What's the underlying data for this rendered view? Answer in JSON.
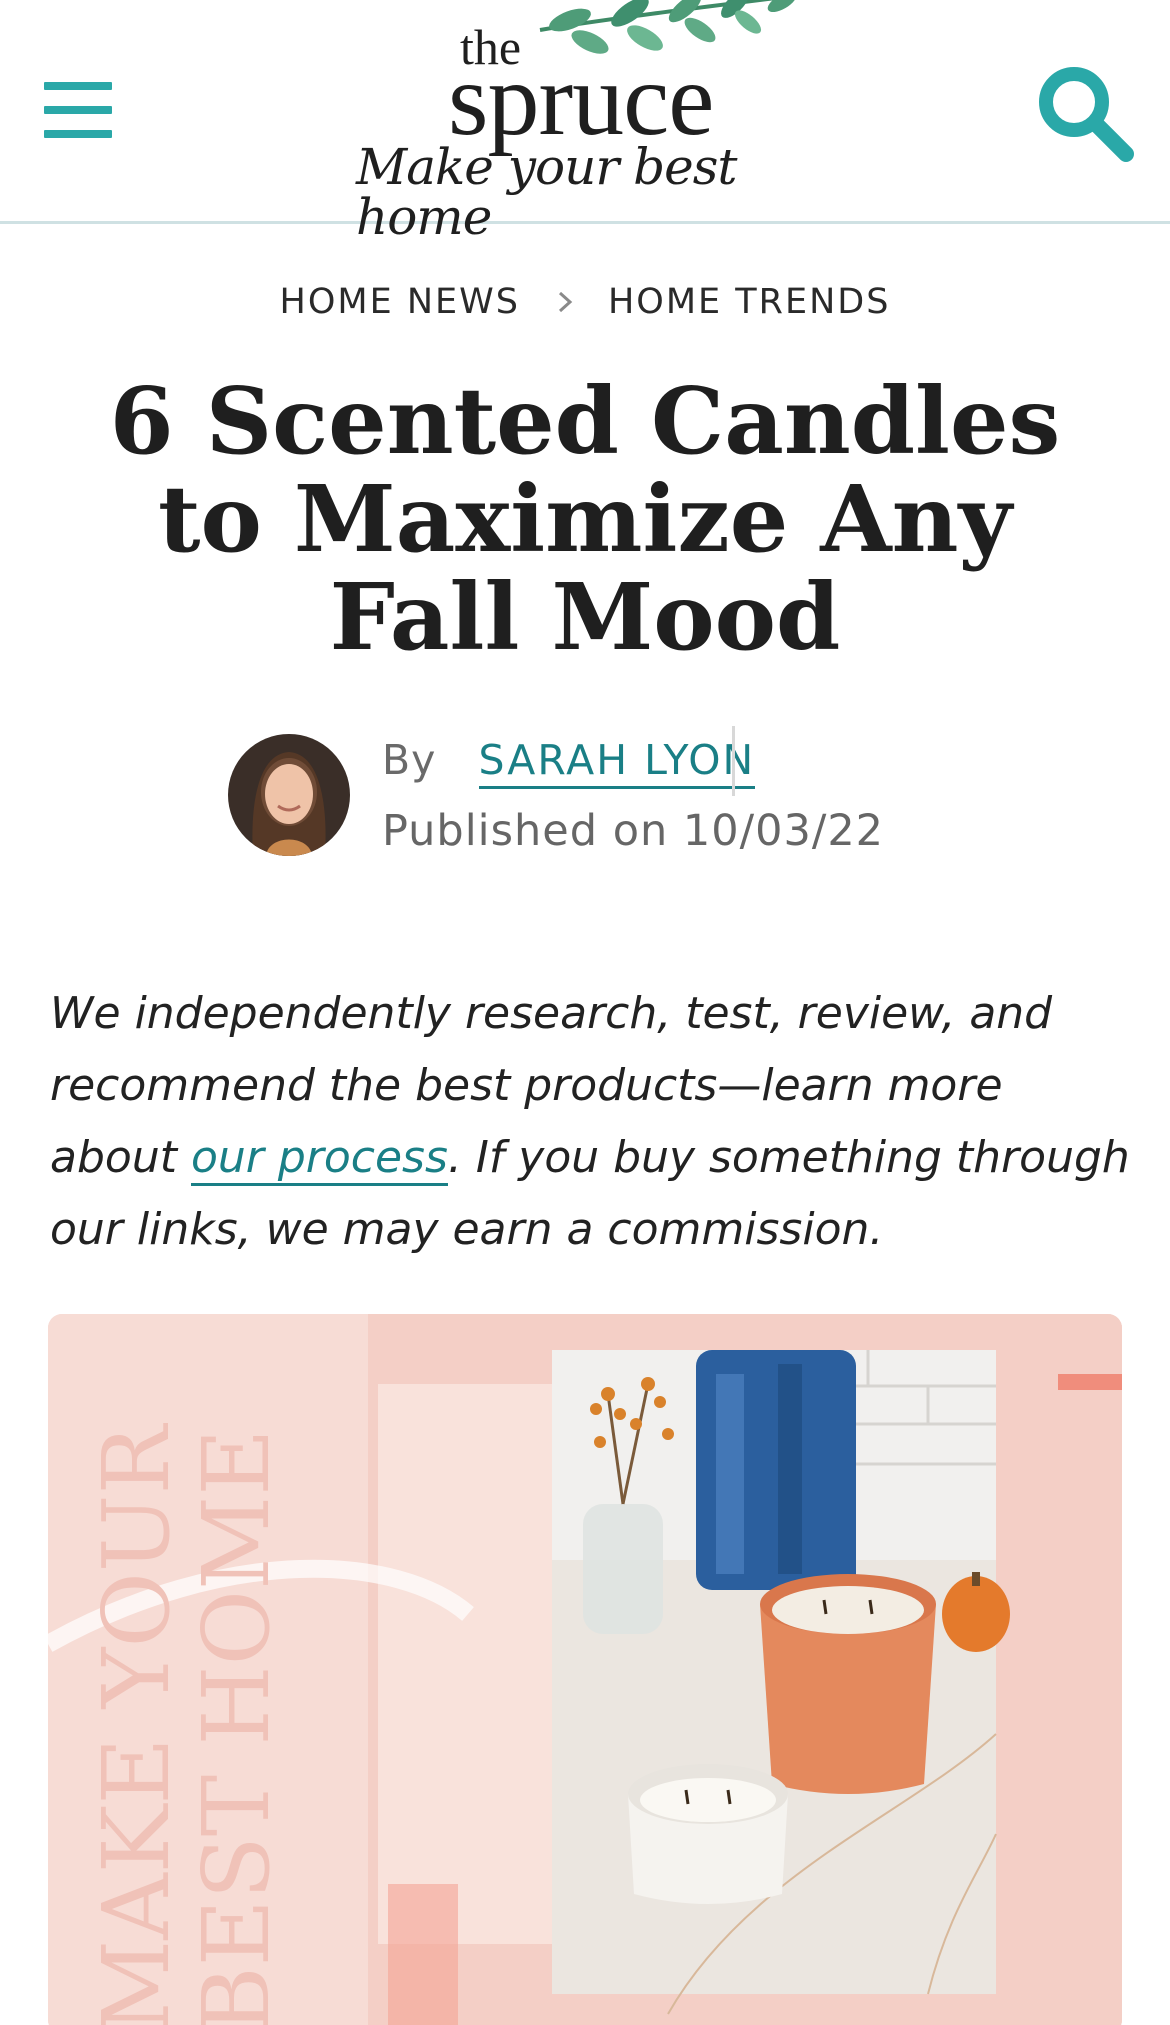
{
  "header": {
    "logo_the": "the",
    "logo_spruce": "spruce",
    "logo_tagline": "Make your best home",
    "menu_icon": "hamburger-menu-icon",
    "search_icon": "search-icon",
    "accent": "#2aa8a8"
  },
  "breadcrumb": {
    "items": [
      "HOME NEWS",
      "HOME TRENDS"
    ],
    "separator_icon": "chevron-right-icon"
  },
  "article": {
    "title": "6 Scented Candles to Maximize Any Fall Mood",
    "by_prefix": "By",
    "author": "SARAH LYON",
    "published": "Published on 10/03/22",
    "link_color": "#1a7f86"
  },
  "disclosure": {
    "part1": "We independently research, test, review, and recommend the best products—learn more about ",
    "link": "our process",
    "part2": ". If you buy something through our links, we may earn a commission."
  },
  "hero": {
    "watermark_line1": "MAKE YOUR",
    "watermark_line2": "BEST HOME"
  }
}
